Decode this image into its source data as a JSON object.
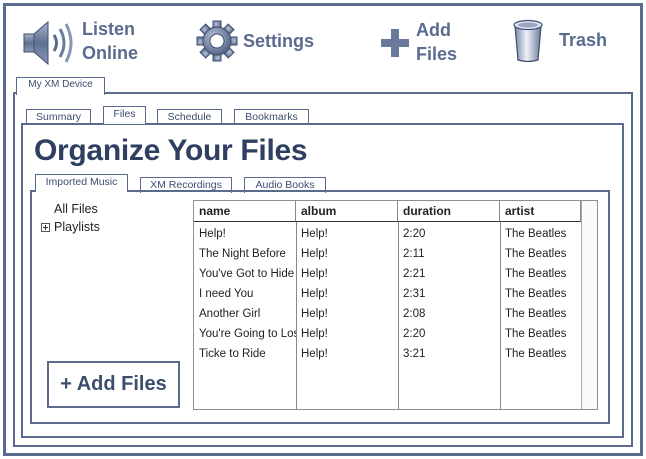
{
  "toolbar": {
    "listen_online": [
      "Listen",
      "Online"
    ],
    "settings": "Settings",
    "add_files": [
      "Add",
      "Files"
    ],
    "trash": "Trash"
  },
  "device_tab": "My XM Device",
  "top_tabs": [
    "Summary",
    "Files",
    "Schedule",
    "Bookmarks"
  ],
  "active_top_tab": "Files",
  "page_title": "Organize Your Files",
  "sub_tabs": [
    "Imported Music",
    "XM Recordings",
    "Audio Books"
  ],
  "active_sub_tab": "Imported Music",
  "tree": {
    "all_files": "All Files",
    "playlists": "Playlists"
  },
  "add_files_button": "+ Add Files",
  "table": {
    "columns": [
      "name",
      "album",
      "duration",
      "artist"
    ],
    "rows": [
      [
        "Help!",
        "Help!",
        "2:20",
        "The Beatles"
      ],
      [
        "The Night Before",
        "Help!",
        "2:11",
        "The Beatles"
      ],
      [
        "You've Got to Hide Your Love Away",
        "Help!",
        "2:21",
        "The Beatles"
      ],
      [
        "I need You",
        "Help!",
        "2:31",
        "The Beatles"
      ],
      [
        "Another Girl",
        "Help!",
        "2:08",
        "The Beatles"
      ],
      [
        "You're Going to Lose That Girl",
        "Help!",
        "2:20",
        "The Beatles"
      ],
      [
        "Ticke to Ride",
        "Help!",
        "3:21",
        "The Beatles"
      ]
    ]
  },
  "colors": {
    "frame": "#5a6b8e",
    "title": "#2f3f62"
  }
}
